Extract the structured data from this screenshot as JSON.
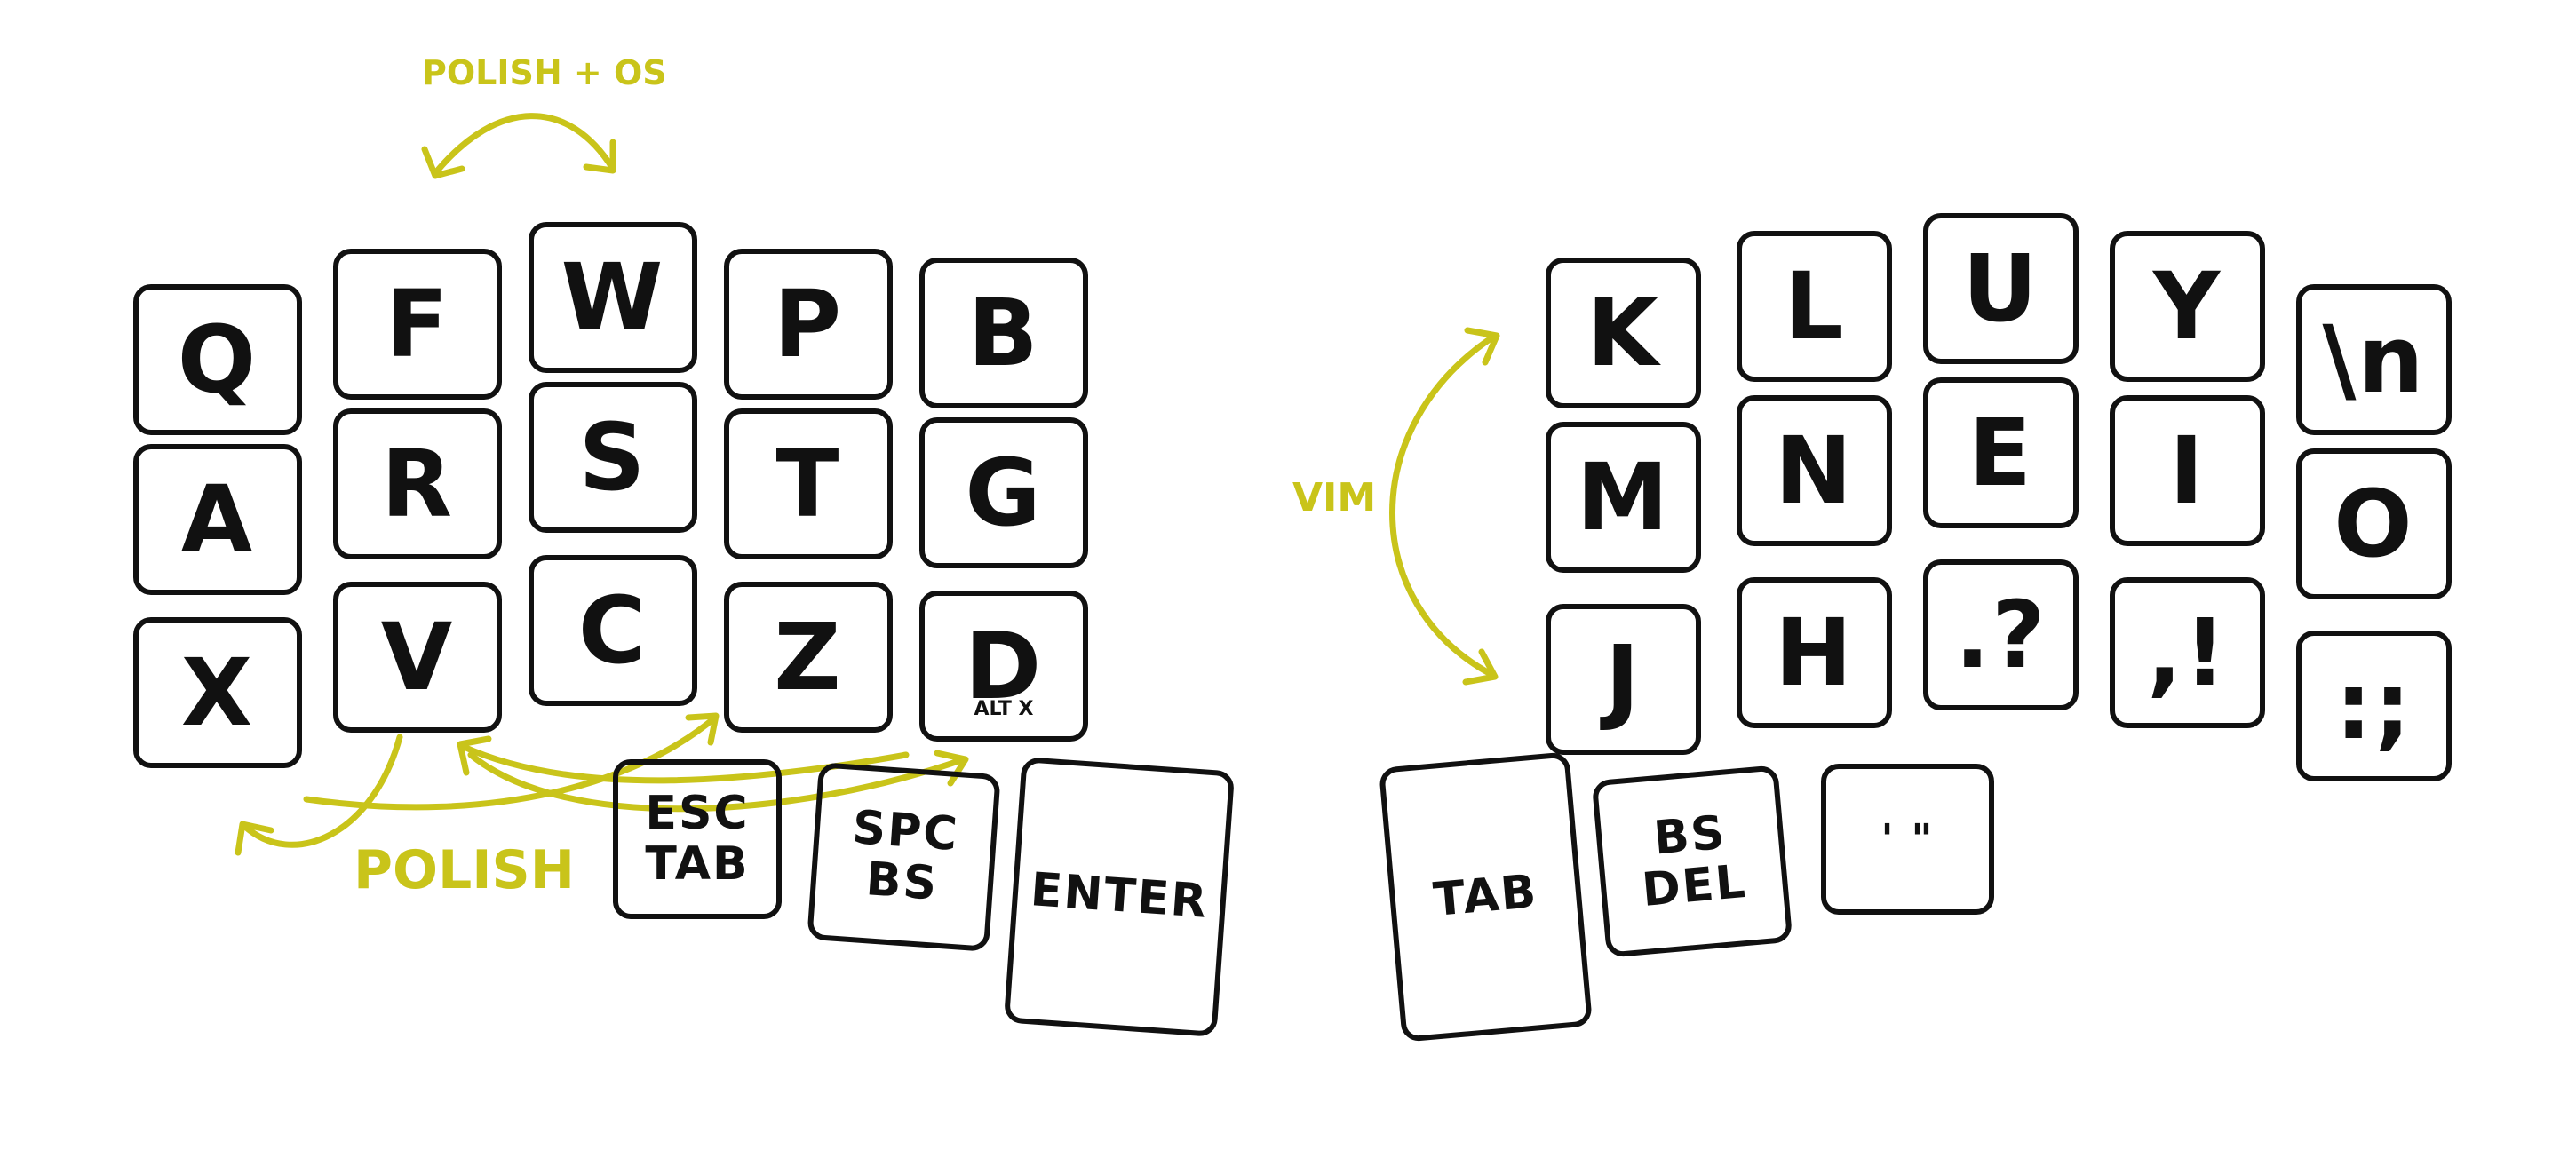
{
  "accent_color": "#c9c41a",
  "left_half": {
    "rows": [
      [
        "Q",
        "F",
        "W",
        "P",
        "B"
      ],
      [
        "A",
        "R",
        "S",
        "T",
        "G"
      ],
      [
        "X",
        "V",
        "C",
        "Z",
        "D"
      ]
    ],
    "d_sublabel": "ALT X",
    "thumbs": {
      "esc_tab": [
        "ESC",
        "TAB"
      ],
      "spc_bs": "SPC BS",
      "enter": "ENTER"
    }
  },
  "right_half": {
    "rows": [
      [
        "K",
        "L",
        "U",
        "Y",
        "\\n"
      ],
      [
        "M",
        "N",
        "E",
        "I",
        "O"
      ],
      [
        "J",
        "H",
        ".?",
        ",!",
        ":;"
      ]
    ],
    "thumbs": {
      "tab": "TAB",
      "bs_del": "BS DEL",
      "quotes": "' \""
    }
  },
  "annotations": {
    "polish_os": "POLISH + OS",
    "polish": "POLISH",
    "vim": "VIM"
  }
}
